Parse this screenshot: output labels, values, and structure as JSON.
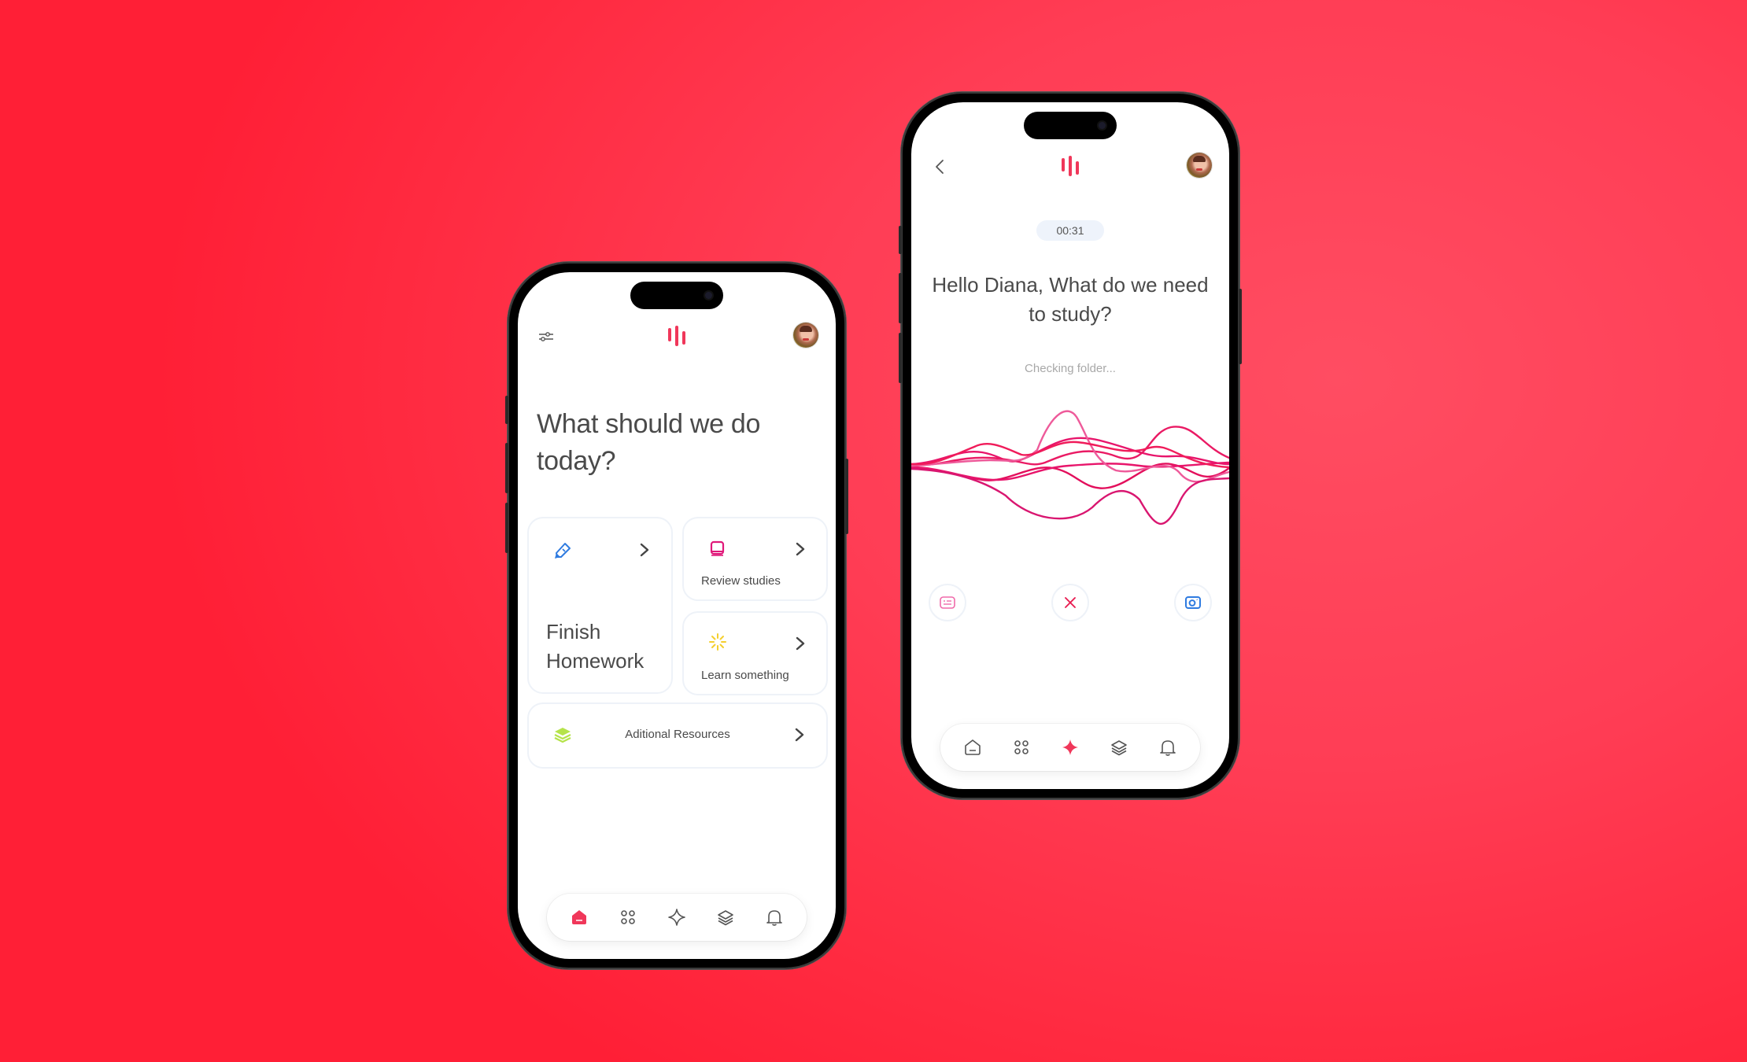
{
  "colors": {
    "accent": "#f0375a",
    "text": "#4a4a4a",
    "muted": "#a8a8a8",
    "card_border": "#eef2f8",
    "pencil_blue": "#2f7be0",
    "book_pink": "#e0197a",
    "sparkle_yellow": "#f4cf2e",
    "layers_green": "#b5e34a",
    "camera_blue": "#2f7be0"
  },
  "home_screen": {
    "header": {
      "left_icon": "sliders-icon",
      "logo_icon": "sound-bars-logo",
      "avatar_label": "User avatar"
    },
    "title": "What should we do today?",
    "cards": {
      "finish_homework": {
        "label": "Finish Homework",
        "icon": "pencil-icon"
      },
      "review_studies": {
        "label": "Review studies",
        "icon": "book-icon"
      },
      "learn_something": {
        "label": "Learn something",
        "icon": "sparkle-burst-icon"
      },
      "additional_resources": {
        "label": "Aditional Resources",
        "icon": "layers-icon"
      }
    },
    "tabbar": {
      "active": "home",
      "items": [
        "home",
        "apps",
        "sparkle",
        "layers",
        "notifications"
      ]
    }
  },
  "voice_screen": {
    "header": {
      "left_icon": "back-chevron-icon",
      "logo_icon": "sound-bars-logo",
      "avatar_label": "User avatar"
    },
    "timer": "00:31",
    "greeting": "Hello Diana, What do we need to study?",
    "status": "Checking folder...",
    "controls": [
      "captions-icon",
      "close-icon",
      "camera-icon"
    ],
    "tabbar": {
      "active": "sparkle",
      "items": [
        "home",
        "apps",
        "sparkle",
        "layers",
        "notifications"
      ]
    }
  }
}
